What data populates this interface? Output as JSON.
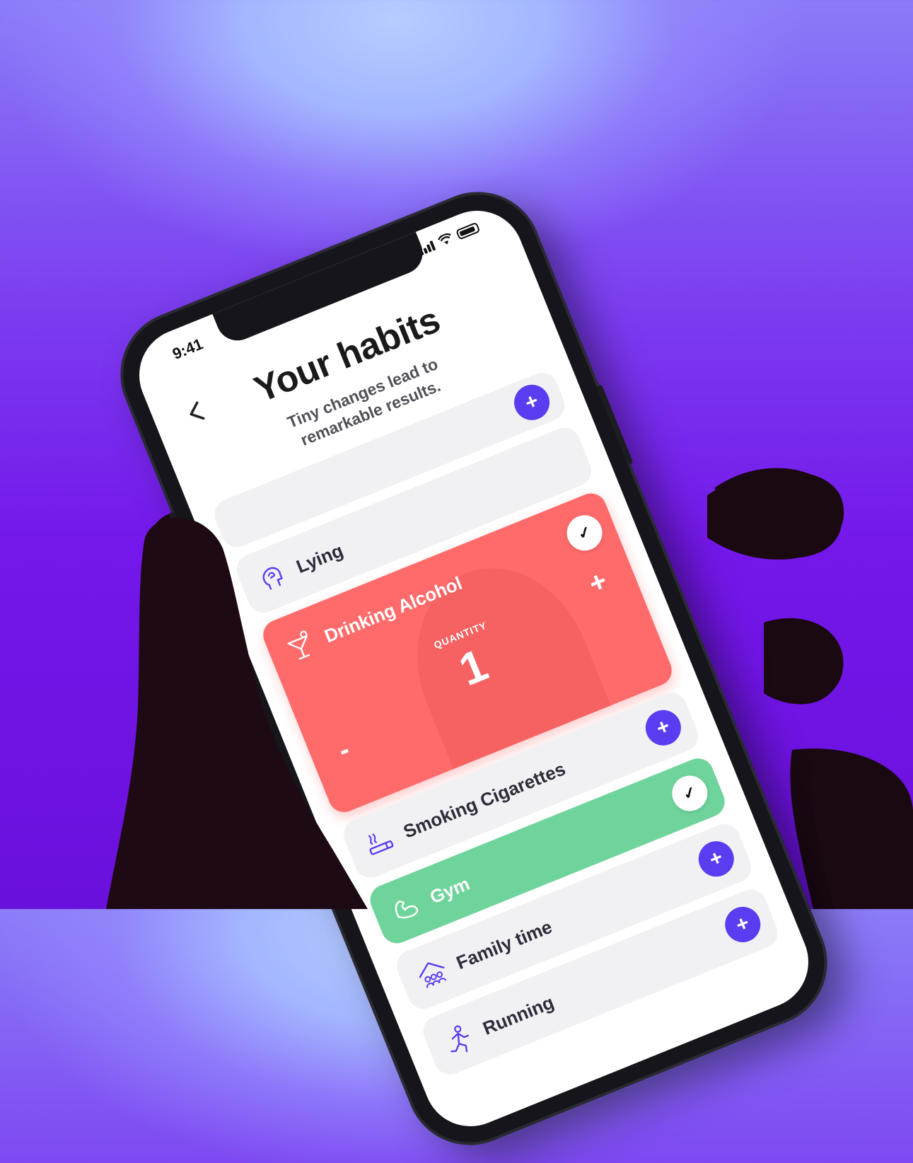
{
  "status": {
    "time": "9:41"
  },
  "header": {
    "title": "Your habits",
    "subtitle": "Tiny changes lead to remarkable results."
  },
  "habits": [
    {
      "label": "Lying",
      "icon": "head-icon",
      "action": "+"
    },
    {
      "label": "Drinking Alcohol",
      "icon": "cocktail-icon",
      "action": "check",
      "quantity_label": "QUANTITY",
      "quantity": "1",
      "plus": "+",
      "minus": "-"
    },
    {
      "label": "Smoking Cigarettes",
      "icon": "cigarette-icon",
      "action": "+"
    },
    {
      "label": "Gym",
      "icon": "flexed-arm-icon",
      "action": "check"
    },
    {
      "label": "Family time",
      "icon": "family-house-icon",
      "action": "+"
    },
    {
      "label": "Running",
      "icon": "runner-icon",
      "action": "+"
    }
  ],
  "symbols": {
    "plus": "+",
    "check": "✓"
  },
  "colors": {
    "accent": "#5a3df0",
    "alcohol_card": "#ff6b6b",
    "gym_card": "#6fd49b",
    "card_bg": "#f1f1f3"
  }
}
